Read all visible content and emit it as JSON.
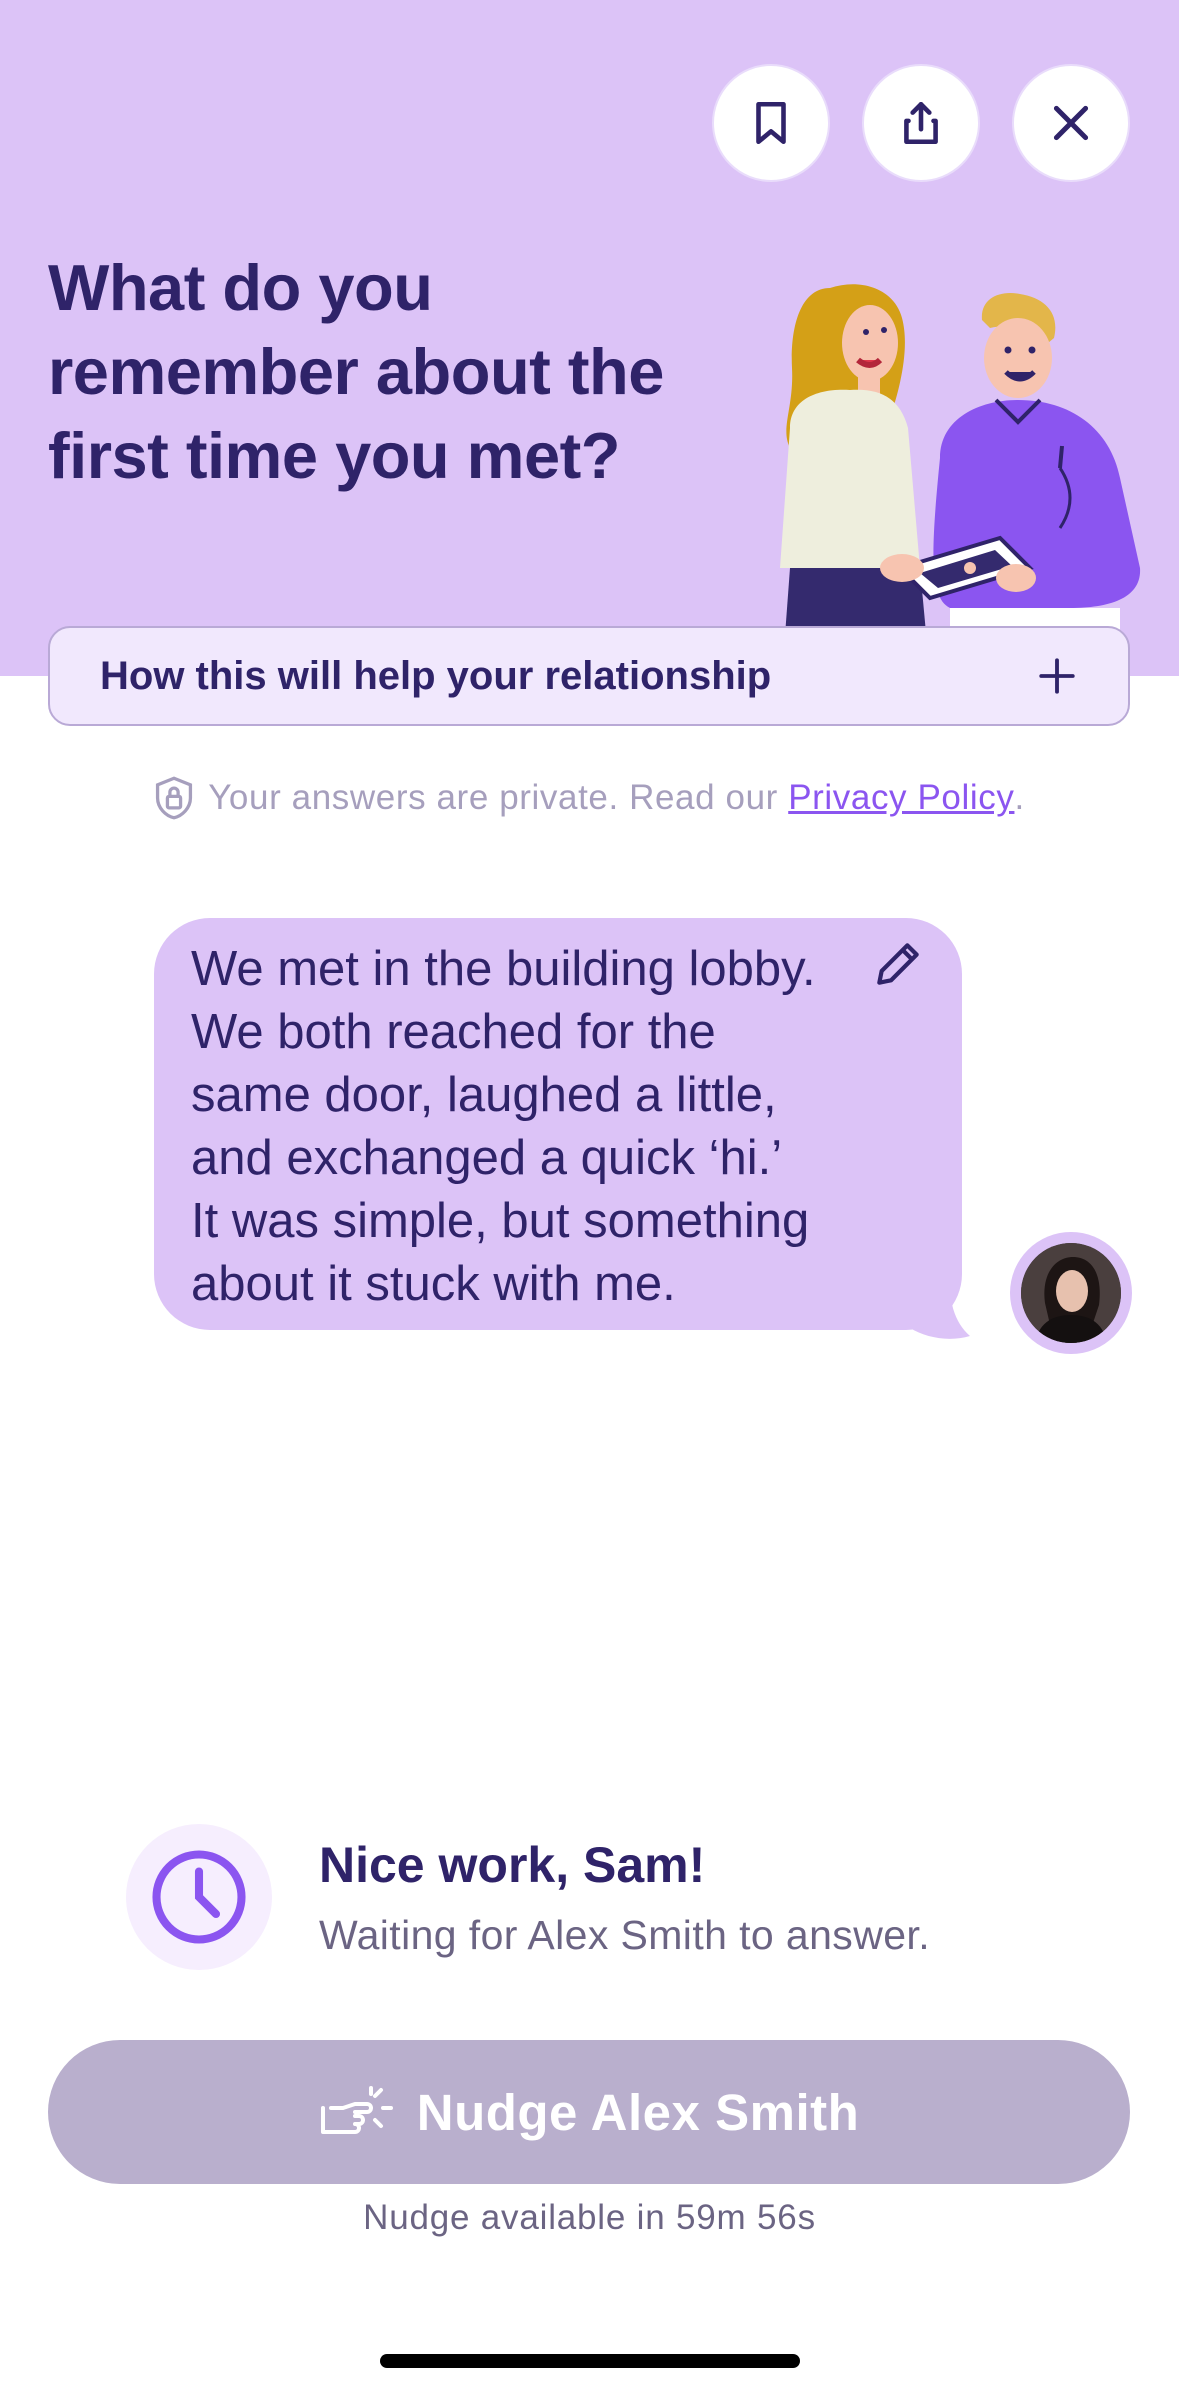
{
  "prompt": {
    "title": "What do you remember about the first time you met?"
  },
  "toolbar": {
    "bookmark_icon": "bookmark-icon",
    "share_icon": "share-icon",
    "close_icon": "close-icon"
  },
  "help": {
    "label": "How this will help your relationship",
    "icon": "plus-icon"
  },
  "privacy": {
    "text": "Your answers are private. Read our",
    "link": "Privacy Policy",
    "suffix": "."
  },
  "answer": {
    "text": "We met in the building lobby.\nWe both reached for the\nsame door, laughed a little,\nand exchanged a quick ‘hi.’\nIt was simple, but something\nabout it stuck with me.",
    "edit_icon": "pencil-icon"
  },
  "status": {
    "title": "Nice work, Sam!",
    "subtitle": "Waiting for Alex Smith to answer.",
    "icon": "clock-icon"
  },
  "nudge": {
    "label": "Nudge Alex Smith",
    "note": "Nudge available in 59m 56s",
    "icon": "nudge-hand-icon"
  },
  "colors": {
    "hero_bg": "#dcc3f7",
    "text_dark": "#2f2369",
    "accent": "#8b55f0",
    "button_disabled": "#b9afcd"
  }
}
